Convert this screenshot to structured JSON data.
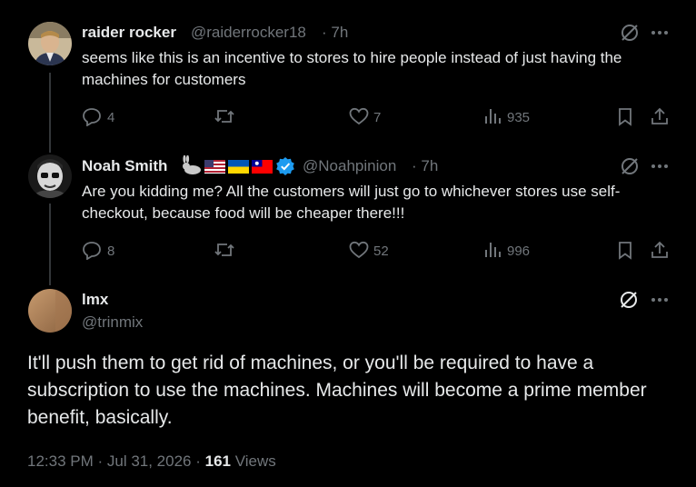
{
  "tweets": [
    {
      "display_name": "raider rocker",
      "handle": "@raiderrocker18",
      "time": "· 7h",
      "text": "seems like this is an incentive to stores to hire people instead of just having the machines for customers",
      "replies": "4",
      "likes": "7",
      "views": "935"
    },
    {
      "display_name": "Noah Smith",
      "handle": "@Noahpinion",
      "time": "· 7h",
      "text": "Are you kidding me? All the customers will just go to whichever stores use self-checkout, because food will be cheaper there!!!",
      "replies": "8",
      "likes": "52",
      "views": "996"
    }
  ],
  "main_tweet": {
    "display_name": "lmx",
    "handle": "@trinmix",
    "text": "It'll push them to get rid of machines, or you'll be required to have a subscription to use the machines. Machines will become a prime member benefit, basically.",
    "timestamp": "12:33 PM · Jul 31, 2026 ·",
    "views_count": "161",
    "views_label": "Views"
  },
  "icons": {
    "reply": "reply-icon",
    "retweet": "retweet-icon",
    "like": "heart-icon",
    "views": "views-icon",
    "bookmark": "bookmark-icon",
    "share": "share-icon",
    "grok": "grok-icon",
    "more": "more-icon",
    "verified": "verified-icon",
    "rabbit": "rabbit-icon"
  },
  "colors": {
    "background": "#000000",
    "text": "#e7e9ea",
    "muted": "#71767b",
    "verified": "#1d9bf0"
  }
}
